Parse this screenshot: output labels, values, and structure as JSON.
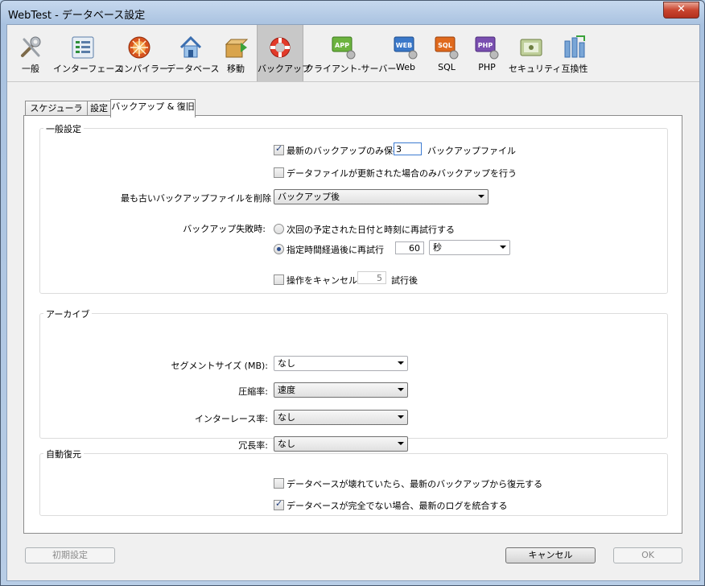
{
  "window": {
    "title": "WebTest - データベース設定",
    "close": "✕"
  },
  "toolbar": [
    {
      "label": "一般",
      "icon": "tools-icon"
    },
    {
      "label": "インターフェース",
      "icon": "interface-icon"
    },
    {
      "label": "コンパイラー",
      "icon": "compiler-icon"
    },
    {
      "label": "データベース",
      "icon": "database-icon"
    },
    {
      "label": "移動",
      "icon": "move-icon"
    },
    {
      "label": "バックアップ",
      "icon": "backup-lifebuoy-icon",
      "selected": true
    },
    {
      "label": "クライアント-サーバー",
      "icon": "app-icon",
      "badge": "APP"
    },
    {
      "label": "Web",
      "icon": "web-icon",
      "badge": "WEB"
    },
    {
      "label": "SQL",
      "icon": "sql-icon",
      "badge": "SQL"
    },
    {
      "label": "PHP",
      "icon": "php-icon",
      "badge": "PHP"
    },
    {
      "label": "セキュリティ",
      "icon": "security-icon"
    },
    {
      "label": "互換性",
      "icon": "compatibility-icon"
    }
  ],
  "tabs": [
    "スケジューラー",
    "設定",
    "バックアップ & 復旧"
  ],
  "general": {
    "title": "一般設定",
    "keep_latest_label": "最新のバックアップのみ保存",
    "keep_latest_checked": true,
    "keep_count": "3",
    "keep_unit": "バックアップファイル",
    "only_if_modified_label": "データファイルが更新された場合のみバックアップを行う",
    "only_if_modified_checked": false,
    "delete_oldest_label": "最も古いバックアップファイルを削除",
    "delete_oldest_value": "バックアップ後",
    "on_failure_label": "バックアップ失敗時:",
    "retry_next_label": "次回の予定された日付と時刻に再試行する",
    "retry_after_label": "指定時間経過後に再試行",
    "retry_after_value": "60",
    "retry_after_unit": "秒",
    "selected_option": "retry_after",
    "cancel_label": "操作をキャンセル",
    "cancel_checked": false,
    "cancel_count": "5",
    "cancel_suffix": "試行後"
  },
  "archive": {
    "title": "アーカイブ",
    "segment_label": "セグメントサイズ (MB):",
    "segment_value": "なし",
    "compression_label": "圧縮率:",
    "compression_value": "速度",
    "interlace_label": "インターレース率:",
    "interlace_value": "なし",
    "redundancy_label": "冗長率:",
    "redundancy_value": "なし"
  },
  "auto_restore": {
    "title": "自動復元",
    "restore_label": "データベースが壊れていたら、最新のバックアップから復元する",
    "restore_checked": false,
    "integrate_label": "データベースが完全でない場合、最新のログを統合する",
    "integrate_checked": true
  },
  "footer": {
    "defaults": "初期設定",
    "cancel": "キャンセル",
    "ok": "OK"
  }
}
